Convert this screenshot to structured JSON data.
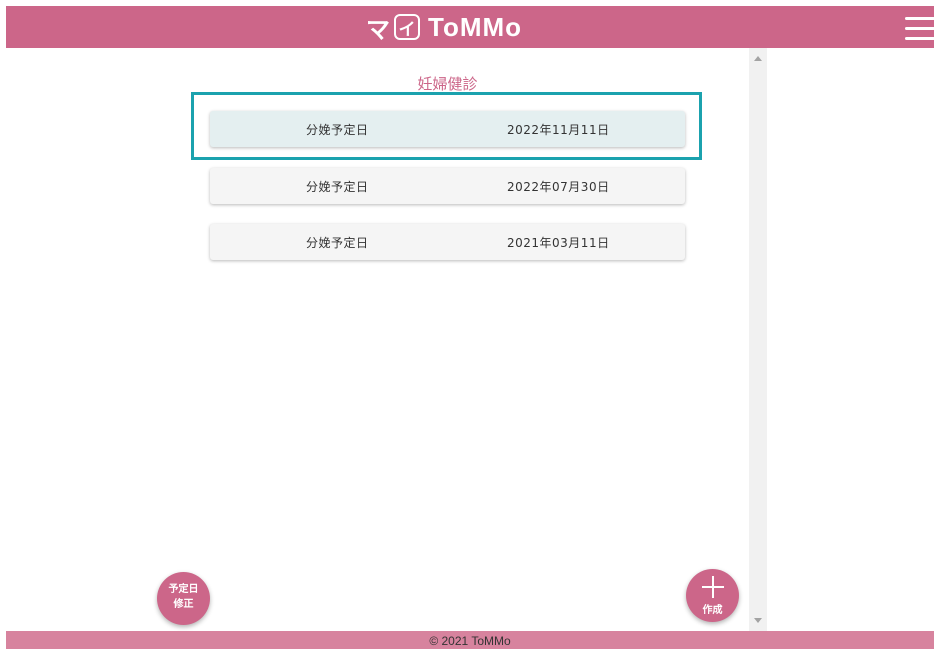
{
  "header": {
    "logo_prefix": "マ",
    "logo_box": "イ",
    "logo_word": "ToMMo",
    "background": "#cc6689"
  },
  "main": {
    "section_title": "妊婦健診",
    "cards": [
      {
        "label": "分娩予定日",
        "date": "2022年11月11日",
        "selected": true
      },
      {
        "label": "分娩予定日",
        "date": "2022年07月30日",
        "selected": false
      },
      {
        "label": "分娩予定日",
        "date": "2021年03月11日",
        "selected": false
      }
    ]
  },
  "fab_edit": {
    "line1": "予定日",
    "line2": "修正"
  },
  "fab_create": {
    "label": "作成",
    "icon": "plus-icon"
  },
  "footer": {
    "text": "© 2021 ToMMo"
  },
  "colors": {
    "accent": "#cc6689",
    "highlight": "#1ba2ae",
    "selected_card": "#e4eff0"
  }
}
